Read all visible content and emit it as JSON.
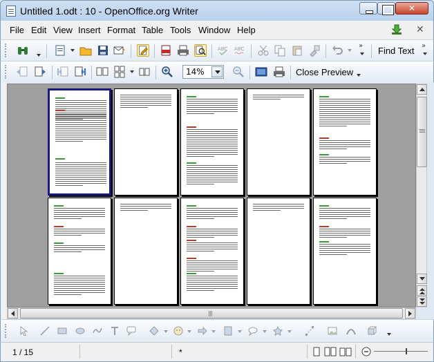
{
  "window": {
    "title": "Untitled 1.odt : 10 - OpenOffice.org Writer"
  },
  "menu": [
    "File",
    "Edit",
    "View",
    "Insert",
    "Format",
    "Table",
    "Tools",
    "Window",
    "Help"
  ],
  "toolbar_standard": {
    "find_text_label": "Find Text",
    "overflow": "»"
  },
  "toolbar_preview": {
    "zoom_value": "14%",
    "close_preview_label": "Close Preview"
  },
  "status": {
    "page_indicator": "1 / 15",
    "modified_marker": "*"
  },
  "colors": {
    "selection_border": "#1a1a7a",
    "heading_red": "#c0392b",
    "heading_green": "#3a9a3a",
    "doc_background": "#a0a0a0"
  }
}
